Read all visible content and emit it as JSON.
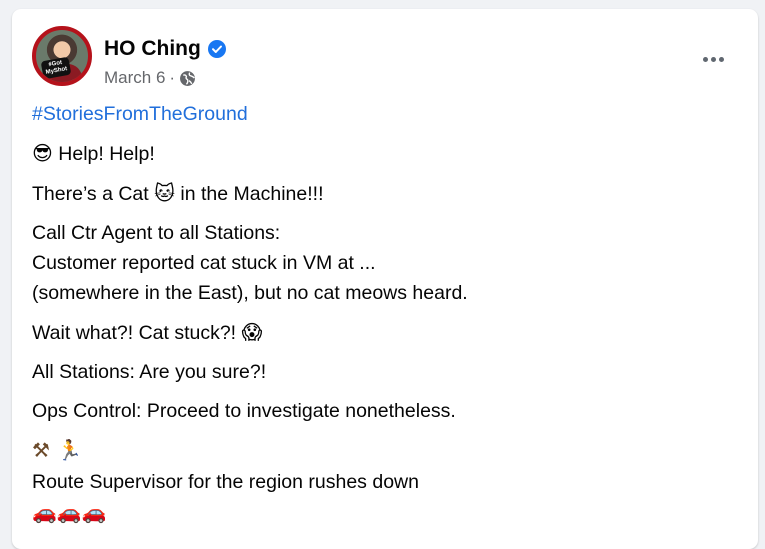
{
  "post": {
    "author": "HO Ching",
    "date": "March 6",
    "separator": "·",
    "avatar_badge": "#Got MyShot",
    "hashtag": "#StoriesFromTheGround",
    "lines": {
      "help": "Help! Help!",
      "cat_pre": "There’s a Cat",
      "cat_post": "in the Machine!!!",
      "call_1": "Call Ctr Agent to all Stations:",
      "call_2": "Customer reported cat stuck in VM at  ...",
      "call_3": "(somewhere in the East), but no cat meows heard.",
      "wait": "Wait what?! Cat stuck?!",
      "stations": "All Stations: Are you sure?!",
      "ops": "Ops Control: Proceed to investigate nonetheless.",
      "route": "Route Supervisor for the region rushes down"
    },
    "emojis": {
      "sunglasses": "😎",
      "cat": "🐱",
      "scream": "😱",
      "tools": "⚒",
      "runner": "🏃",
      "cars": "🚗🚗🚗"
    }
  },
  "icons": {
    "verified": "verified-badge-icon",
    "globe": "globe-icon",
    "more": "more-options-icon"
  },
  "colors": {
    "link": "#216fdb",
    "verified": "#1877f2",
    "muted": "#65676b",
    "background": "#f0f2f5",
    "avatar_ring": "#b5121b"
  }
}
